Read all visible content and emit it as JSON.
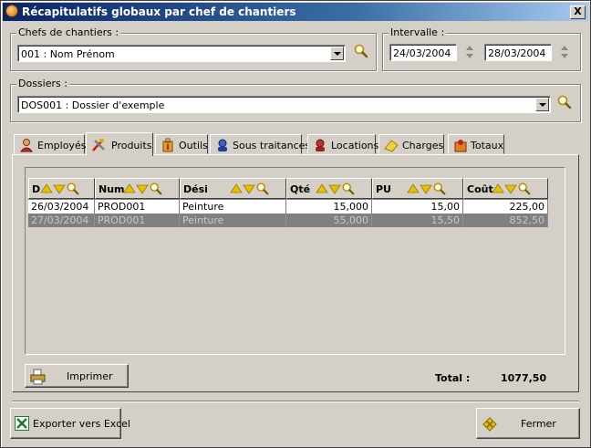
{
  "window": {
    "title": "Récapitulatifs globaux par chef de chantiers",
    "close_label": "X"
  },
  "chefs": {
    "label": "Chefs de chantiers :",
    "value": "001 : Nom Prénom"
  },
  "intervalle": {
    "label": "Intervalle :",
    "date_from": "24/03/2004",
    "date_to": "28/03/2004"
  },
  "dossiers": {
    "label": "Dossiers :",
    "value": "DOS001 : Dossier d'exemple"
  },
  "tabs": [
    {
      "label": "Employés",
      "icon": "employee-icon"
    },
    {
      "label": "Produits",
      "icon": "tools-icon",
      "active": true
    },
    {
      "label": "Outils",
      "icon": "toolbox-icon"
    },
    {
      "label": "Sous traitances",
      "icon": "subcontract-icon"
    },
    {
      "label": "Locations",
      "icon": "rental-icon"
    },
    {
      "label": "Charges",
      "icon": "charges-icon"
    },
    {
      "label": "Totaux",
      "icon": "totals-icon"
    }
  ],
  "table": {
    "columns": [
      "D",
      "Num",
      "Dési",
      "Qté",
      "PU",
      "Coût"
    ],
    "rows": [
      {
        "date": "26/03/2004",
        "num": "PROD001",
        "desi": "Peinture",
        "qte": "15,000",
        "pu": "15,00",
        "cout": "225,00"
      },
      {
        "date": "27/03/2004",
        "num": "PROD001",
        "desi": "Peinture",
        "qte": "55,000",
        "pu": "15,50",
        "cout": "852,50"
      }
    ]
  },
  "actions": {
    "print_label": "Imprimer",
    "total_label": "Total :",
    "total_value": "1077,50",
    "export_label": "Exporter vers Excel",
    "close_label": "Fermer"
  },
  "colors": {
    "titlebar": "#0a246a",
    "face": "#d4d0c8",
    "sort_arrow": "#e8c000",
    "excel_green": "#1d7a2e"
  }
}
